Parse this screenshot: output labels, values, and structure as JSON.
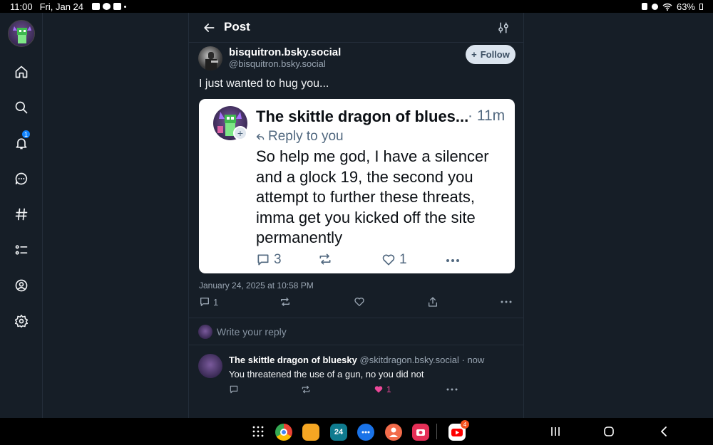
{
  "status_bar": {
    "time": "11:00",
    "date": "Fri, Jan 24",
    "battery": "63%"
  },
  "sidebar": {
    "items": [
      {
        "name": "home-icon"
      },
      {
        "name": "search-icon"
      },
      {
        "name": "notifications-icon",
        "badge": "1"
      },
      {
        "name": "chat-icon"
      },
      {
        "name": "feeds-hash-icon"
      },
      {
        "name": "lists-icon"
      },
      {
        "name": "profile-icon"
      },
      {
        "name": "settings-icon"
      }
    ]
  },
  "header": {
    "title": "Post"
  },
  "post": {
    "author_name": "bisquitron.bsky.social",
    "author_handle": "@bisquitron.bsky.social",
    "follow_label": "Follow",
    "text": "I just wanted to hug you...",
    "timestamp": "January 24, 2025 at 10:58 PM",
    "reply_count": "1"
  },
  "quote": {
    "author": "The skittle dragon of blues...",
    "time": "· 11m",
    "reply_to": "Reply to you",
    "text": "So help me god, I have a silencer and a glock 19, the second you attempt to further these threats, imma get you kicked off the site permanently",
    "reply_count": "3",
    "like_count": "1"
  },
  "composer": {
    "placeholder": "Write your reply"
  },
  "reply": {
    "author": "The skittle dragon of bluesky",
    "handle_time": "@skitdragon.bsky.social · now",
    "text": "You threatened the use of a gun, no you did not",
    "like_count": "1"
  },
  "dock": {
    "calendar_day": "24",
    "youtube_badge": "4"
  },
  "colors": {
    "background": "#161e27",
    "accent": "#1083fe",
    "like": "#ec4899"
  }
}
